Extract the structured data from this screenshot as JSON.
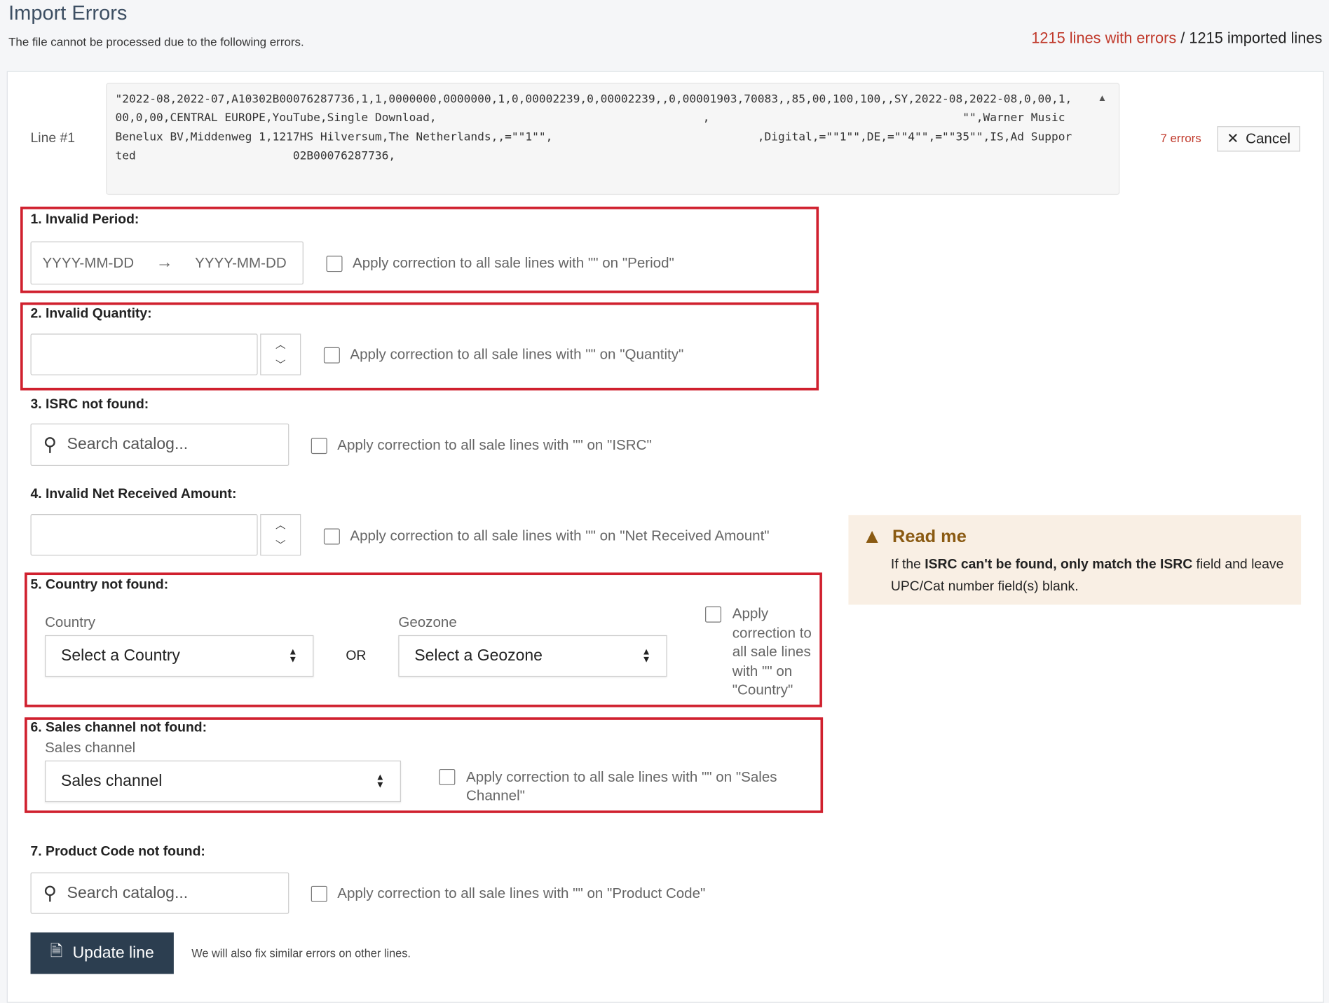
{
  "header": {
    "title": "Import Errors",
    "subtitle": "The file cannot be processed due to the following errors.",
    "errors_count": "1215 lines with errors",
    "separator": " / ",
    "imported_count": "1215 imported lines"
  },
  "line": {
    "label": "Line #1",
    "raw": "\"2022-08,2022-07,A10302B00076287736,1,1,0000000,0000000,1,0,00002239,0,00002239,,0,00001903,70083,,85,00,100,100,,SY,2022-08,2022-08,0,00,1,00,0,00,CENTRAL EUROPE,YouTube,Single Download,                                       ,                                     \"\",Warner Music Benelux BV,Middenweg 1,1217HS Hilversum,The Netherlands,,=\"\"1\"\",                              ,Digital,=\"\"1\"\",DE,=\"\"4\"\",=\"\"35\"\",IS,Ad Supported                       02B00076287736,",
    "error_count": "7 errors",
    "cancel_label": "Cancel"
  },
  "sections": {
    "period": {
      "title": "1. Invalid Period:",
      "from_placeholder": "YYYY-MM-DD",
      "to_placeholder": "YYYY-MM-DD",
      "apply": "Apply correction to all sale lines with \"\" on \"Period\""
    },
    "quantity": {
      "title": "2. Invalid Quantity:",
      "value": "",
      "apply": "Apply correction to all sale lines with \"\" on \"Quantity\""
    },
    "isrc": {
      "title": "3. ISRC not found:",
      "placeholder": "Search catalog...",
      "apply": "Apply correction to all sale lines with \"\" on \"ISRC\""
    },
    "net": {
      "title": "4. Invalid Net Received Amount:",
      "value": "",
      "apply": "Apply correction to all sale lines with \"\" on \"Net Received Amount\""
    },
    "country": {
      "title": "5. Country not found:",
      "country_label": "Country",
      "country_value": "Select a Country",
      "or": "OR",
      "geozone_label": "Geozone",
      "geozone_value": "Select a Geozone",
      "apply": "Apply correction to all sale lines with \"\" on \"Country\""
    },
    "channel": {
      "title": "6. Sales channel not found:",
      "label": "Sales channel",
      "value": "Sales channel",
      "apply": "Apply correction to all sale lines with \"\" on \"Sales Channel\""
    },
    "product": {
      "title": "7. Product Code not found:",
      "placeholder": "Search catalog...",
      "apply": "Apply correction to all sale lines with \"\" on \"Product Code\""
    }
  },
  "readme": {
    "title": "Read me",
    "text_pre": "If the ",
    "text_bold": "ISRC can't be found, only match the ISRC",
    "text_post": " field and leave UPC/Cat number field(s) blank.",
    "color": "#8a5a12"
  },
  "footer": {
    "update_label": "Update line",
    "note": "We will also fix similar errors on other lines."
  },
  "colors": {
    "error_red": "#c0392b",
    "highlight_box": "#d0202e",
    "primary": "#2c3e50"
  }
}
